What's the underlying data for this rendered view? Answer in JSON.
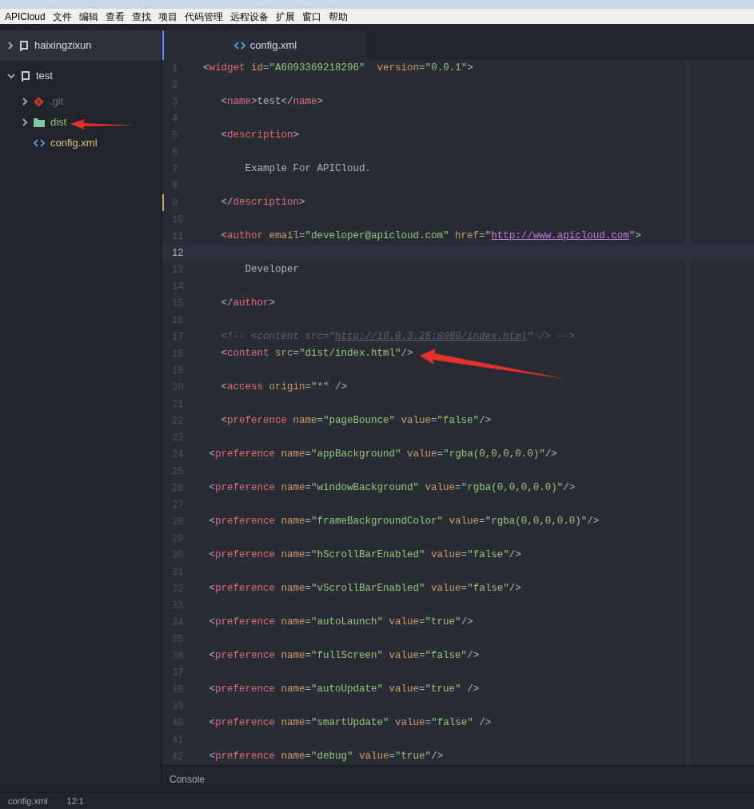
{
  "menu": [
    "APICloud",
    "文件",
    "编辑",
    "查看",
    "查找",
    "项目",
    "代码管理",
    "远程设备",
    "扩展",
    "窗口",
    "帮助"
  ],
  "tree": [
    {
      "label": "haixingzixun",
      "kind": "project",
      "expanded": false,
      "selected": true,
      "color": "#d7dae0"
    },
    {
      "label": "test",
      "kind": "project",
      "expanded": true,
      "selected": false,
      "color": "#d7dae0",
      "children": [
        {
          "label": ".git",
          "kind": "git",
          "expanded": false,
          "selected": false,
          "color": "#6b717d"
        },
        {
          "label": "dist",
          "kind": "folder",
          "expanded": false,
          "selected": false,
          "color": "#98c379"
        },
        {
          "label": "config.xml",
          "kind": "xml",
          "selected": false,
          "color": "#e5c07b"
        }
      ]
    }
  ],
  "tab": {
    "label": "config.xml",
    "selected": true
  },
  "lines": [
    {
      "number": "1",
      "current": false,
      "modified": false,
      "tokens": [
        {
          "kind": "p",
          "text": "<"
        },
        {
          "kind": "tag",
          "text": "widget"
        },
        {
          "kind": "attr",
          "text": " id"
        },
        {
          "kind": "p",
          "text": "="
        },
        {
          "kind": "str",
          "text": "\"A6093369218296\""
        },
        {
          "kind": "attr",
          "text": "  version"
        },
        {
          "kind": "p",
          "text": "="
        },
        {
          "kind": "str",
          "text": "\"0.0.1\""
        },
        {
          "kind": "p",
          "text": ">"
        }
      ]
    },
    {
      "number": "2",
      "current": false,
      "modified": false
    },
    {
      "number": "3",
      "current": false,
      "modified": false,
      "tokens": [
        {
          "kind": "p",
          "text": "   <"
        },
        {
          "kind": "tag",
          "text": "name"
        },
        {
          "kind": "p",
          "text": ">"
        },
        {
          "kind": "text",
          "text": "test"
        },
        {
          "kind": "p",
          "text": "</"
        },
        {
          "kind": "tag",
          "text": "name"
        },
        {
          "kind": "p",
          "text": ">"
        }
      ]
    },
    {
      "number": "4",
      "current": false,
      "modified": false
    },
    {
      "number": "5",
      "current": false,
      "modified": false,
      "tokens": [
        {
          "kind": "p",
          "text": "   <"
        },
        {
          "kind": "tag",
          "text": "description"
        },
        {
          "kind": "p",
          "text": ">"
        }
      ]
    },
    {
      "number": "6",
      "current": false,
      "modified": false
    },
    {
      "number": "7",
      "current": false,
      "modified": false,
      "tokens": [
        {
          "kind": "text",
          "text": "       Example For APICloud."
        }
      ]
    },
    {
      "number": "8",
      "current": false,
      "modified": false
    },
    {
      "number": "9",
      "current": false,
      "modified": true,
      "tokens": [
        {
          "kind": "p",
          "text": "   </"
        },
        {
          "kind": "tag",
          "text": "description"
        },
        {
          "kind": "p",
          "text": ">"
        }
      ]
    },
    {
      "number": "10",
      "current": false,
      "modified": false
    },
    {
      "number": "11",
      "current": false,
      "modified": false,
      "tokens": [
        {
          "kind": "p",
          "text": "   <"
        },
        {
          "kind": "tag",
          "text": "author"
        },
        {
          "kind": "attr",
          "text": " email"
        },
        {
          "kind": "p",
          "text": "="
        },
        {
          "kind": "str",
          "text": "\"developer@apicloud.com\""
        },
        {
          "kind": "attr",
          "text": " href"
        },
        {
          "kind": "p",
          "text": "="
        },
        {
          "kind": "str",
          "text": "\""
        },
        {
          "kind": "link",
          "text": "http://www.apicloud.com"
        },
        {
          "kind": "str",
          "text": "\""
        },
        {
          "kind": "p",
          "text": ">"
        }
      ]
    },
    {
      "number": "12",
      "current": true,
      "modified": false
    },
    {
      "number": "13",
      "current": false,
      "modified": false,
      "tokens": [
        {
          "kind": "text",
          "text": "       Developer"
        }
      ]
    },
    {
      "number": "14",
      "current": false,
      "modified": false
    },
    {
      "number": "15",
      "current": false,
      "modified": false,
      "tokens": [
        {
          "kind": "p",
          "text": "   </"
        },
        {
          "kind": "tag",
          "text": "author"
        },
        {
          "kind": "p",
          "text": ">"
        }
      ]
    },
    {
      "number": "16",
      "current": false,
      "modified": false
    },
    {
      "number": "17",
      "current": false,
      "modified": false,
      "tokens": [
        {
          "kind": "comment",
          "text": "   <!-- <content src=\""
        },
        {
          "kind": "clink",
          "text": "http://10.0.3.25:8080/index.html"
        },
        {
          "kind": "comment",
          "text": "\" /> -->"
        }
      ]
    },
    {
      "number": "18",
      "current": false,
      "modified": false,
      "tokens": [
        {
          "kind": "p",
          "text": "   <"
        },
        {
          "kind": "tag",
          "text": "content"
        },
        {
          "kind": "attr",
          "text": " src"
        },
        {
          "kind": "p",
          "text": "="
        },
        {
          "kind": "str",
          "text": "\"dist/index.html\""
        },
        {
          "kind": "p",
          "text": "/>"
        }
      ]
    },
    {
      "number": "19",
      "current": false,
      "modified": false
    },
    {
      "number": "20",
      "current": false,
      "modified": false,
      "tokens": [
        {
          "kind": "p",
          "text": "   <"
        },
        {
          "kind": "tag",
          "text": "access"
        },
        {
          "kind": "attr",
          "text": " origin"
        },
        {
          "kind": "p",
          "text": "="
        },
        {
          "kind": "str",
          "text": "\"*\""
        },
        {
          "kind": "p",
          "text": " />"
        }
      ]
    },
    {
      "number": "21",
      "current": false,
      "modified": false
    },
    {
      "number": "22",
      "current": false,
      "modified": false,
      "tokens": [
        {
          "kind": "p",
          "text": "   <"
        },
        {
          "kind": "tag",
          "text": "preference"
        },
        {
          "kind": "attr",
          "text": " name"
        },
        {
          "kind": "p",
          "text": "="
        },
        {
          "kind": "str",
          "text": "\"pageBounce\""
        },
        {
          "kind": "attr",
          "text": " value"
        },
        {
          "kind": "p",
          "text": "="
        },
        {
          "kind": "str",
          "text": "\"false\""
        },
        {
          "kind": "p",
          "text": "/>"
        }
      ]
    },
    {
      "number": "23",
      "current": false,
      "modified": false
    },
    {
      "number": "24",
      "current": false,
      "modified": false,
      "tokens": [
        {
          "kind": "p",
          "text": " <"
        },
        {
          "kind": "tag",
          "text": "preference"
        },
        {
          "kind": "attr",
          "text": " name"
        },
        {
          "kind": "p",
          "text": "="
        },
        {
          "kind": "str",
          "text": "\"appBackground\""
        },
        {
          "kind": "attr",
          "text": " value"
        },
        {
          "kind": "p",
          "text": "="
        },
        {
          "kind": "str",
          "text": "\"rgba(0,0,0,0.0)\""
        },
        {
          "kind": "p",
          "text": "/>"
        }
      ]
    },
    {
      "number": "25",
      "current": false,
      "modified": false
    },
    {
      "number": "26",
      "current": false,
      "modified": false,
      "tokens": [
        {
          "kind": "p",
          "text": " <"
        },
        {
          "kind": "tag",
          "text": "preference"
        },
        {
          "kind": "attr",
          "text": " name"
        },
        {
          "kind": "p",
          "text": "="
        },
        {
          "kind": "str",
          "text": "\"windowBackground\""
        },
        {
          "kind": "attr",
          "text": " value"
        },
        {
          "kind": "p",
          "text": "="
        },
        {
          "kind": "str",
          "text": "\"rgba(0,0,0,0.0)\""
        },
        {
          "kind": "p",
          "text": "/>"
        }
      ]
    },
    {
      "number": "27",
      "current": false,
      "modified": false
    },
    {
      "number": "28",
      "current": false,
      "modified": false,
      "tokens": [
        {
          "kind": "p",
          "text": " <"
        },
        {
          "kind": "tag",
          "text": "preference"
        },
        {
          "kind": "attr",
          "text": " name"
        },
        {
          "kind": "p",
          "text": "="
        },
        {
          "kind": "str",
          "text": "\"frameBackgroundColor\""
        },
        {
          "kind": "attr",
          "text": " value"
        },
        {
          "kind": "p",
          "text": "="
        },
        {
          "kind": "str",
          "text": "\"rgba(0,0,0,0.0)\""
        },
        {
          "kind": "p",
          "text": "/>"
        }
      ]
    },
    {
      "number": "29",
      "current": false,
      "modified": false
    },
    {
      "number": "30",
      "current": false,
      "modified": false,
      "tokens": [
        {
          "kind": "p",
          "text": " <"
        },
        {
          "kind": "tag",
          "text": "preference"
        },
        {
          "kind": "attr",
          "text": " name"
        },
        {
          "kind": "p",
          "text": "="
        },
        {
          "kind": "str",
          "text": "\"hScrollBarEnabled\""
        },
        {
          "kind": "attr",
          "text": " value"
        },
        {
          "kind": "p",
          "text": "="
        },
        {
          "kind": "str",
          "text": "\"false\""
        },
        {
          "kind": "p",
          "text": "/>"
        }
      ]
    },
    {
      "number": "31",
      "current": false,
      "modified": false
    },
    {
      "number": "32",
      "current": false,
      "modified": false,
      "tokens": [
        {
          "kind": "p",
          "text": " <"
        },
        {
          "kind": "tag",
          "text": "preference"
        },
        {
          "kind": "attr",
          "text": " name"
        },
        {
          "kind": "p",
          "text": "="
        },
        {
          "kind": "str",
          "text": "\"vScrollBarEnabled\""
        },
        {
          "kind": "attr",
          "text": " value"
        },
        {
          "kind": "p",
          "text": "="
        },
        {
          "kind": "str",
          "text": "\"false\""
        },
        {
          "kind": "p",
          "text": "/>"
        }
      ]
    },
    {
      "number": "33",
      "current": false,
      "modified": false
    },
    {
      "number": "34",
      "current": false,
      "modified": false,
      "tokens": [
        {
          "kind": "p",
          "text": " <"
        },
        {
          "kind": "tag",
          "text": "preference"
        },
        {
          "kind": "attr",
          "text": " name"
        },
        {
          "kind": "p",
          "text": "="
        },
        {
          "kind": "str",
          "text": "\"autoLaunch\""
        },
        {
          "kind": "attr",
          "text": " value"
        },
        {
          "kind": "p",
          "text": "="
        },
        {
          "kind": "str",
          "text": "\"true\""
        },
        {
          "kind": "p",
          "text": "/>"
        }
      ]
    },
    {
      "number": "35",
      "current": false,
      "modified": false
    },
    {
      "number": "36",
      "current": false,
      "modified": false,
      "tokens": [
        {
          "kind": "p",
          "text": " <"
        },
        {
          "kind": "tag",
          "text": "preference"
        },
        {
          "kind": "attr",
          "text": " name"
        },
        {
          "kind": "p",
          "text": "="
        },
        {
          "kind": "str",
          "text": "\"fullScreen\""
        },
        {
          "kind": "attr",
          "text": " value"
        },
        {
          "kind": "p",
          "text": "="
        },
        {
          "kind": "str",
          "text": "\"false\""
        },
        {
          "kind": "p",
          "text": "/>"
        }
      ]
    },
    {
      "number": "37",
      "current": false,
      "modified": false
    },
    {
      "number": "38",
      "current": false,
      "modified": false,
      "tokens": [
        {
          "kind": "p",
          "text": " <"
        },
        {
          "kind": "tag",
          "text": "preference"
        },
        {
          "kind": "attr",
          "text": " name"
        },
        {
          "kind": "p",
          "text": "="
        },
        {
          "kind": "str",
          "text": "\"autoUpdate\""
        },
        {
          "kind": "attr",
          "text": " value"
        },
        {
          "kind": "p",
          "text": "="
        },
        {
          "kind": "str",
          "text": "\"true\""
        },
        {
          "kind": "p",
          "text": " />"
        }
      ]
    },
    {
      "number": "39",
      "current": false,
      "modified": false
    },
    {
      "number": "40",
      "current": false,
      "modified": false,
      "tokens": [
        {
          "kind": "p",
          "text": " <"
        },
        {
          "kind": "tag",
          "text": "preference"
        },
        {
          "kind": "attr",
          "text": " name"
        },
        {
          "kind": "p",
          "text": "="
        },
        {
          "kind": "str",
          "text": "\"smartUpdate\""
        },
        {
          "kind": "attr",
          "text": " value"
        },
        {
          "kind": "p",
          "text": "="
        },
        {
          "kind": "str",
          "text": "\"false\""
        },
        {
          "kind": "p",
          "text": " />"
        }
      ]
    },
    {
      "number": "41",
      "current": false,
      "modified": false
    },
    {
      "number": "42",
      "current": false,
      "modified": false,
      "tokens": [
        {
          "kind": "p",
          "text": " <"
        },
        {
          "kind": "tag",
          "text": "preference"
        },
        {
          "kind": "attr",
          "text": " name"
        },
        {
          "kind": "p",
          "text": "="
        },
        {
          "kind": "str",
          "text": "\"debug\""
        },
        {
          "kind": "attr",
          "text": " value"
        },
        {
          "kind": "p",
          "text": "="
        },
        {
          "kind": "str",
          "text": "\"true\""
        },
        {
          "kind": "p",
          "text": "/>"
        }
      ]
    }
  ],
  "console": {
    "label": "Console"
  },
  "status_bar": {
    "file": "config.xml",
    "position": "12:1"
  }
}
